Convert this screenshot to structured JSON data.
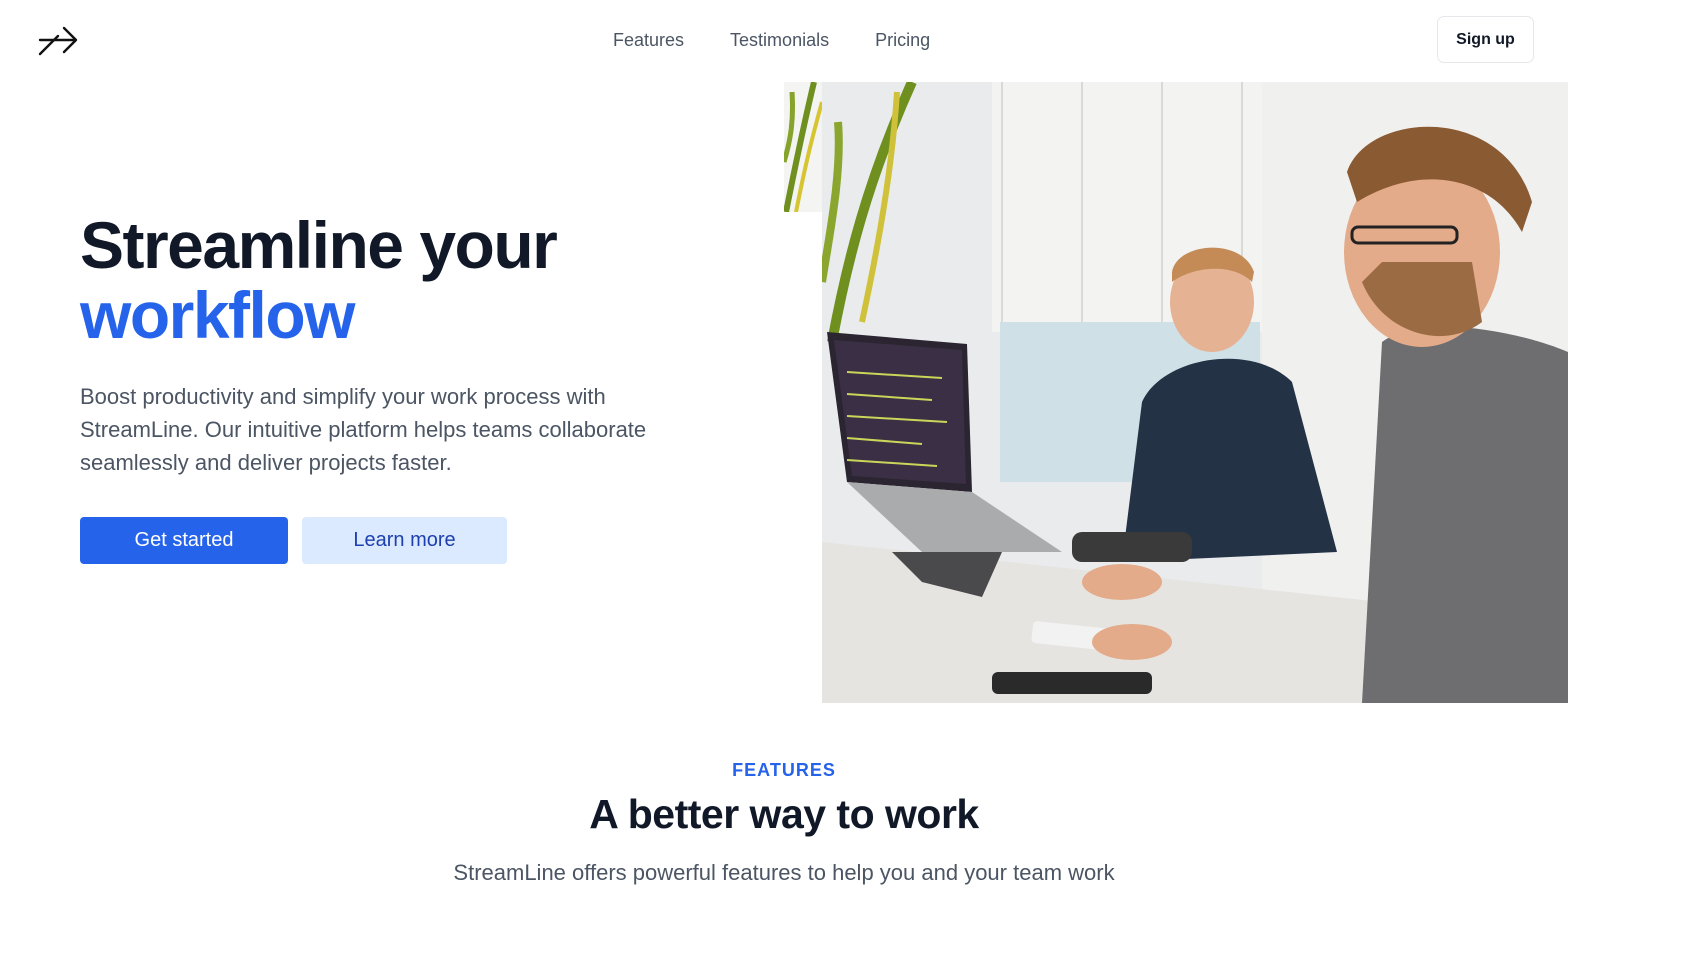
{
  "nav": {
    "logo_icon": "arrow-up-right-icon",
    "links": [
      "Features",
      "Testimonials",
      "Pricing"
    ],
    "signup_label": "Sign up"
  },
  "hero": {
    "title_line1": "Streamline your",
    "title_line2": "workflow",
    "description": "Boost productivity and simplify your work process with StreamLine. Our intuitive platform helps teams collaborate seamlessly and deliver projects faster.",
    "primary_cta": "Get started",
    "secondary_cta": "Learn more",
    "image_description": "photo-two-men-working-laptops-office"
  },
  "features": {
    "eyebrow": "FEATURES",
    "title": "A better way to work",
    "subtitle": "StreamLine offers powerful features to help you and your team work"
  },
  "colors": {
    "accent": "#2563eb",
    "accent_light": "#dbeafe",
    "text_dark": "#111827",
    "text_muted": "#4b5563"
  }
}
